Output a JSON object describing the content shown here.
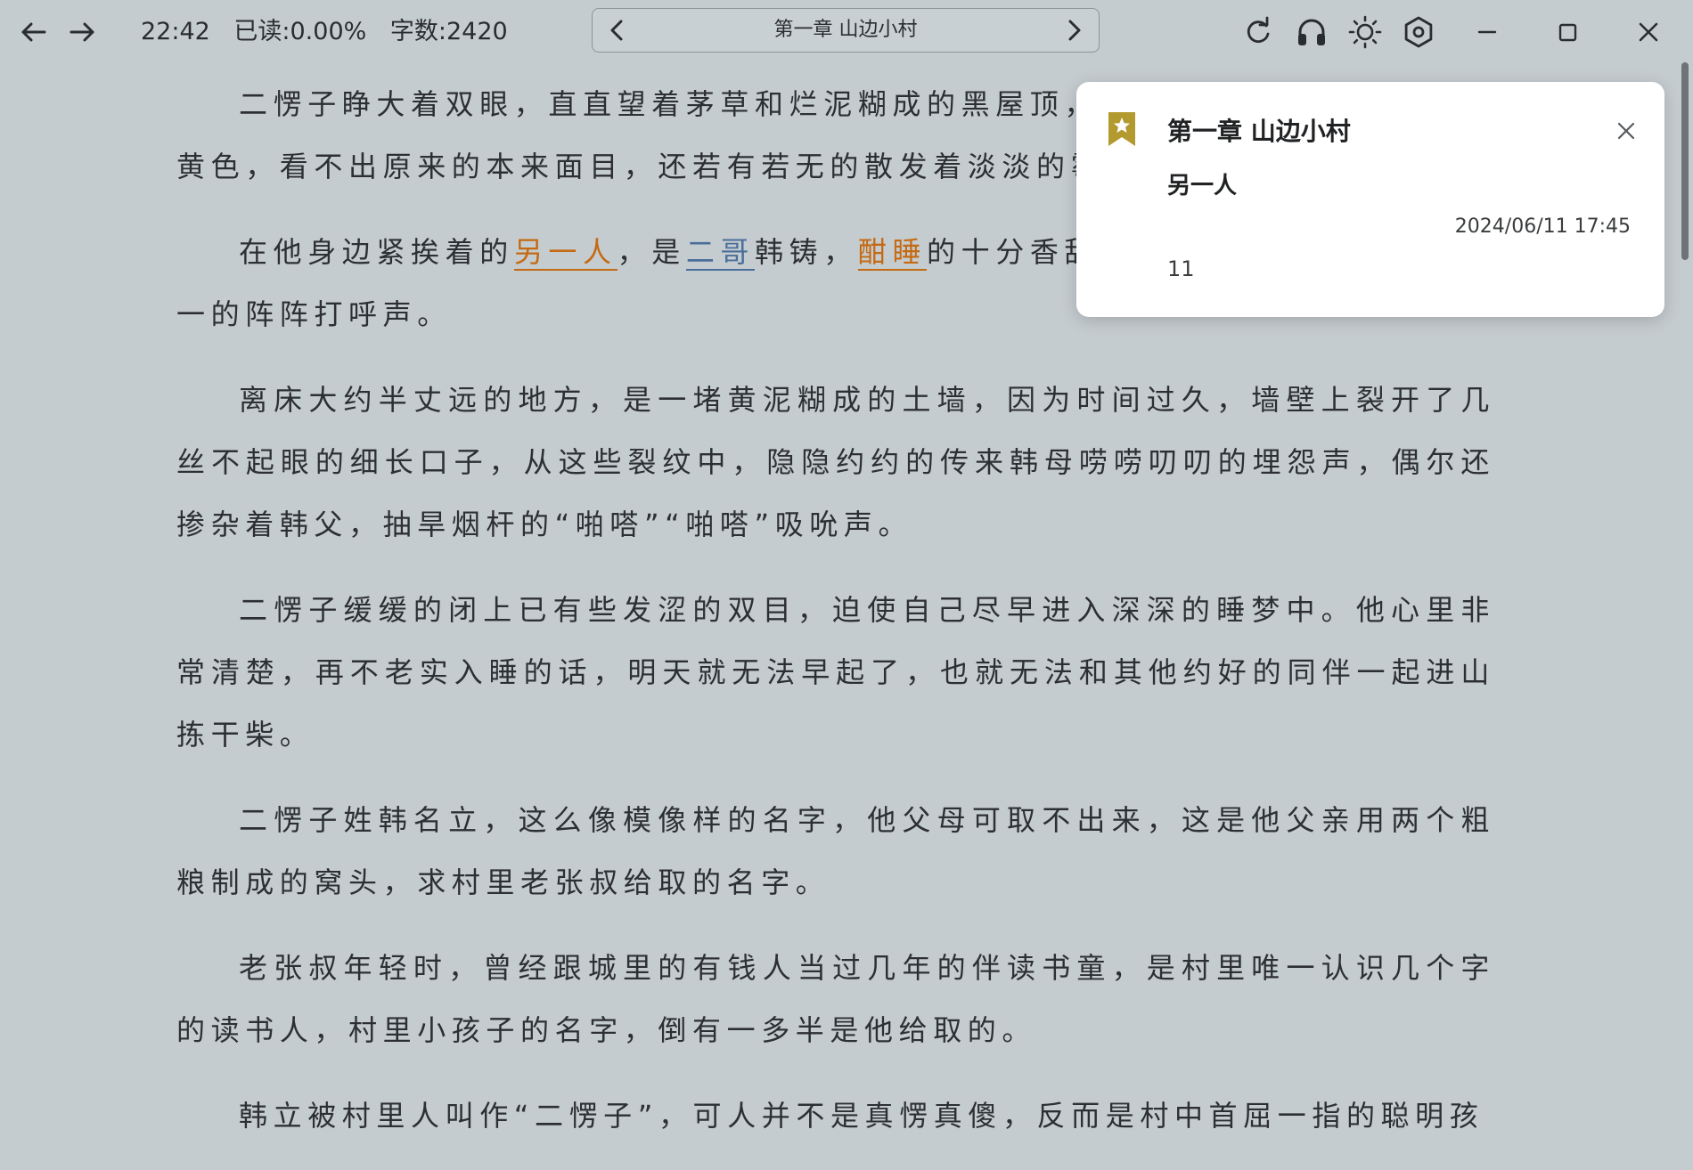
{
  "status": {
    "time": "22:42",
    "progress": "已读:0.00%",
    "words": "字数:2420"
  },
  "chapter_nav": {
    "title": "第一章 山边小村"
  },
  "colors": {
    "highlight_orange": "#c46a12",
    "highlight_blue": "#4a6e9a",
    "bookmark_gold": "#b39a2e"
  },
  "content": {
    "p1_a": "二愣子睁大着双眼，直直望着茅草和烂泥糊成的黑屋顶，",
    "p1_b": "黄色，看不出原来的本来面目，还若有若无的散发着淡淡的霉",
    "p2_a": "在他身边紧挨着的",
    "p2_hl1": "另一人",
    "p2_b": "，是",
    "p2_hl2": "二哥",
    "p2_c": "韩铸，",
    "p2_hl3": "酣睡",
    "p2_d": "的十分香甜",
    "p2_e": "一的阵阵打呼声。",
    "p3": "离床大约半丈远的地方，是一堵黄泥糊成的土墙，因为时间过久，墙壁上裂开了几丝不起眼的细长口子，从这些裂纹中，隐隐约约的传来韩母唠唠叨叨的埋怨声，偶尔还掺杂着韩父，抽旱烟杆的“啪嗒”“啪嗒”吸吮声。",
    "p4": "二愣子缓缓的闭上已有些发涩的双目，迫使自己尽早进入深深的睡梦中。他心里非常清楚，再不老实入睡的话，明天就无法早起了，也就无法和其他约好的同伴一起进山拣干柴。",
    "p5": "二愣子姓韩名立，这么像模像样的名字，他父母可取不出来，这是他父亲用两个粗粮制成的窝头，求村里老张叔给取的名字。",
    "p6": "老张叔年轻时，曾经跟城里的有钱人当过几年的伴读书童，是村里唯一认识几个字的读书人，村里小孩子的名字，倒有一多半是他给取的。",
    "p7": "韩立被村里人叫作“二愣子”，可人并不是真愣真傻，反而是村中首屈一指的聪明孩"
  },
  "bookmark_popup": {
    "chapter": "第一章 山边小村",
    "selected_text": "另一人",
    "timestamp": "2024/06/11 17:45",
    "note": "11"
  }
}
